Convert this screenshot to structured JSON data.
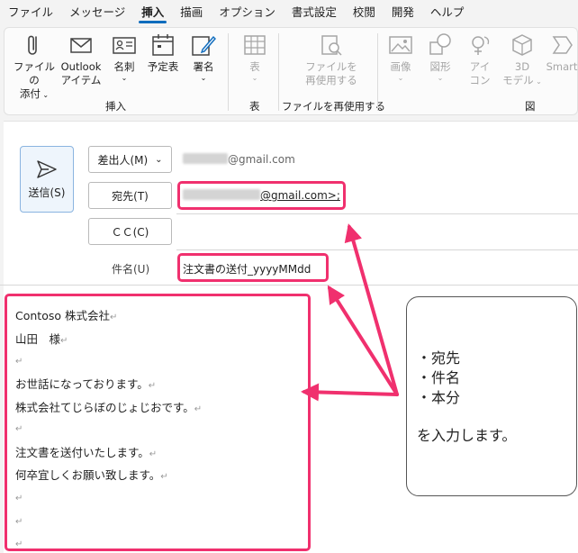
{
  "menu": [
    "ファイル",
    "メッセージ",
    "挿入",
    "描画",
    "オプション",
    "書式設定",
    "校閲",
    "開発",
    "ヘルプ"
  ],
  "menu_active": "挿入",
  "ribbon": {
    "attach_l1": "ファイルの",
    "attach_l2": "添付",
    "outlook_l1": "Outlook",
    "outlook_l2": "アイテム",
    "card_l1": "名刺",
    "schedule_l1": "予定表",
    "signature_l1": "署名",
    "group_insert": "挿入",
    "table_l1": "表",
    "group_table": "表",
    "reuse_l1": "ファイルを",
    "reuse_l2": "再使用する",
    "group_reuse": "ファイルを再使用する",
    "pictures_l1": "画像",
    "shapes_l1": "図形",
    "icons_l1": "アイ",
    "icons_l2": "コン",
    "model_l1": "3D",
    "model_l2": "モデル",
    "smartart_l1": "Smart",
    "group_figure": "図"
  },
  "compose": {
    "send_label": "送信(S)",
    "from_label": "差出人(M)",
    "from_value": "@gmail.com",
    "to_label": "宛先(T)",
    "to_value": "@gmail.com>;",
    "cc_label": "ＣＣ(C)",
    "subject_label": "件名(U)",
    "subject_value": "注文書の送付_yyyyMMdd"
  },
  "body_lines": [
    "Contoso 株式会社",
    "山田　様",
    "",
    "お世話になっております。",
    "株式会社てじらぼのじょじおです。",
    "",
    "注文書を送付いたします。",
    "何卒宜しくお願い致します。",
    "",
    "",
    ""
  ],
  "paragraph_mark": "↵",
  "callout": {
    "line1": "・宛先",
    "line2": "・件名",
    "line3": "・本分",
    "line4": "を入力します。"
  },
  "colors": {
    "highlight": "#f0306e",
    "accent": "#0f6cbd"
  }
}
